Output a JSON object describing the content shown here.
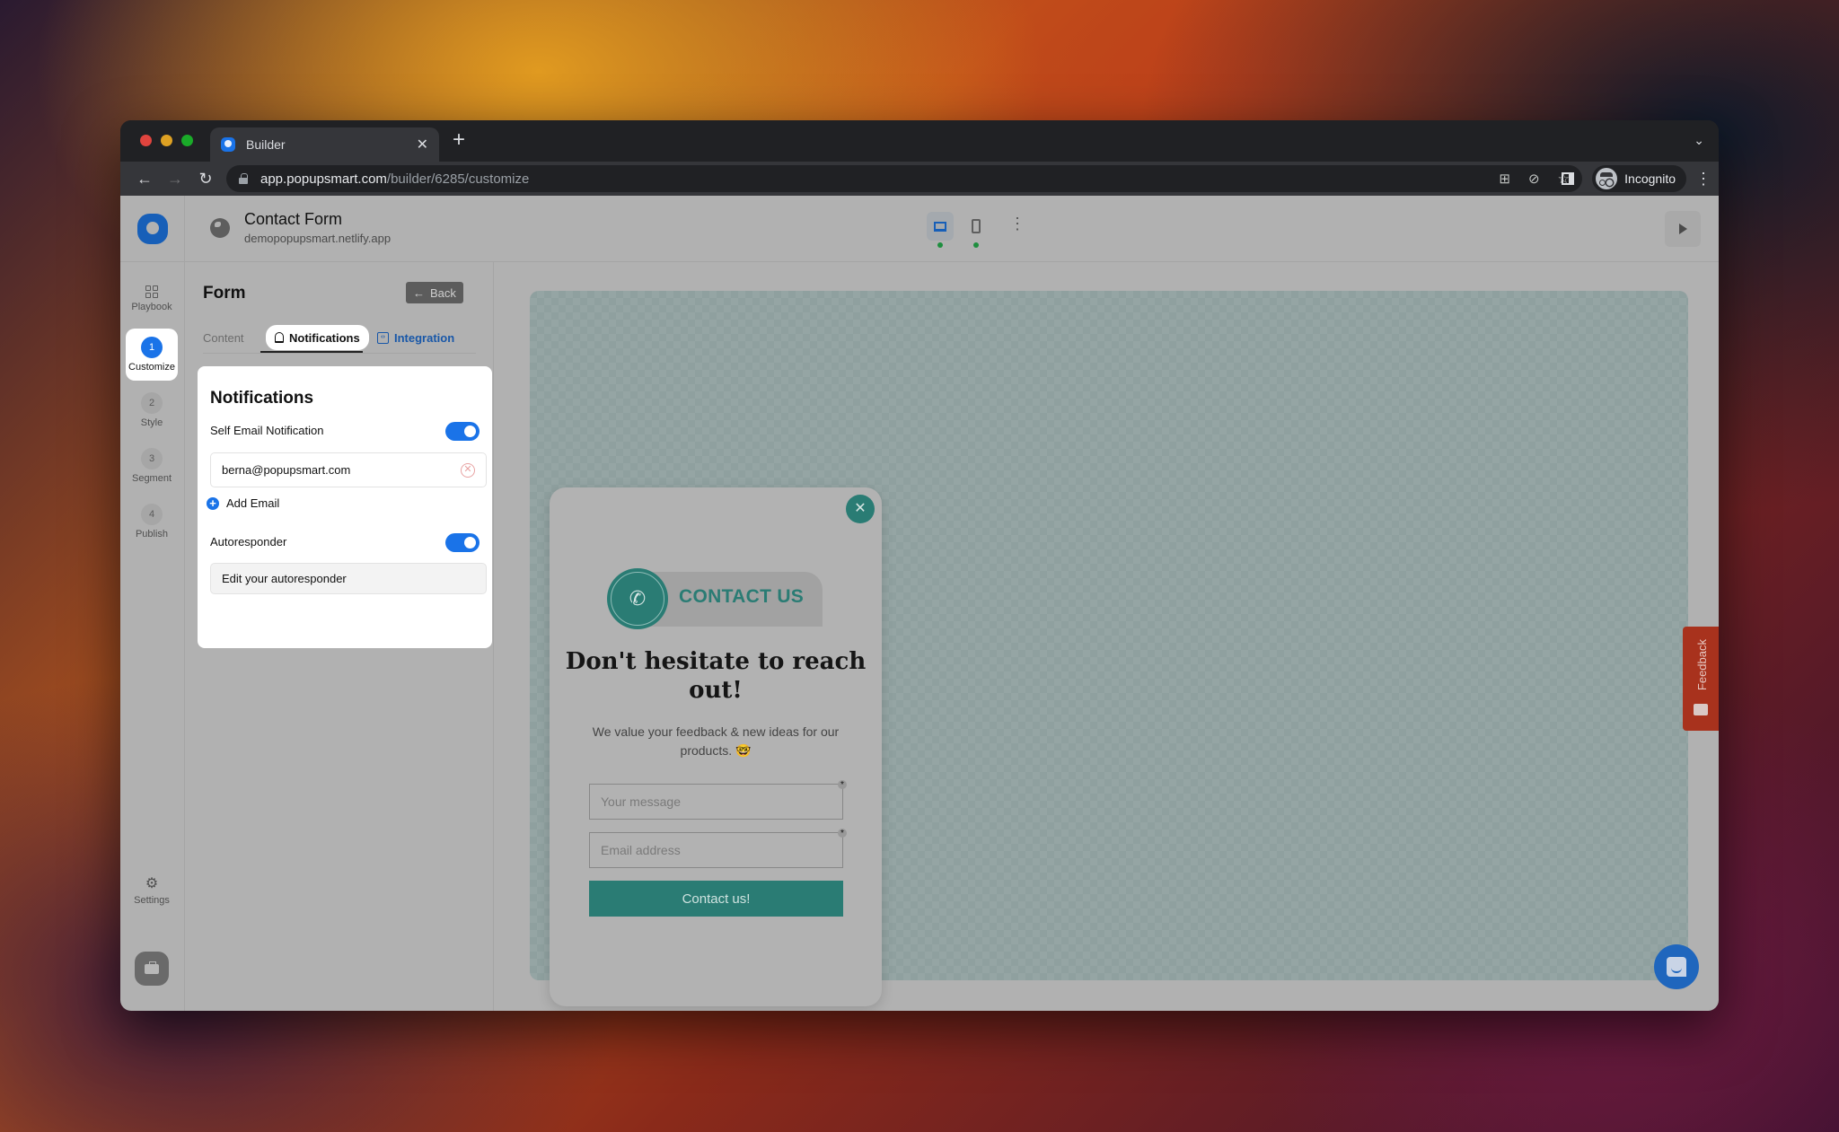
{
  "browser": {
    "tab_title": "Builder",
    "url_host": "app.popupsmart.com",
    "url_path": "/builder/6285/customize",
    "profile_label": "Incognito"
  },
  "header": {
    "project_title": "Contact Form",
    "project_domain": "demopopupsmart.netlify.app",
    "device_modes": [
      "desktop",
      "mobile"
    ],
    "active_device": "desktop"
  },
  "leftnav": {
    "items": [
      {
        "label": "Playbook",
        "icon": "grid-icon"
      },
      {
        "step": "1",
        "label": "Customize",
        "active": true
      },
      {
        "step": "2",
        "label": "Style"
      },
      {
        "step": "3",
        "label": "Segment"
      },
      {
        "step": "4",
        "label": "Publish"
      }
    ],
    "settings_label": "Settings"
  },
  "panel": {
    "title": "Form",
    "back_label": "Back",
    "tabs": [
      {
        "label": "Content"
      },
      {
        "label": "Notifications",
        "active": true
      },
      {
        "label": "Integration"
      }
    ],
    "card": {
      "title": "Notifications",
      "self_email_label": "Self Email Notification",
      "self_email_enabled": true,
      "email_value": "berna@popupsmart.com",
      "add_email_label": "Add Email",
      "autoresponder_label": "Autoresponder",
      "autoresponder_enabled": true,
      "autoresponder_field": "Edit your autoresponder"
    }
  },
  "popup": {
    "badge_text": "CONTACT US",
    "heading": "Don't hesitate to reach out!",
    "description": "We value your feedback & new ideas for our products. 🤓",
    "message_placeholder": "Your message",
    "email_placeholder": "Email address",
    "required_mark": "*",
    "submit_label": "Contact us!"
  },
  "widgets": {
    "feedback_label": "Feedback"
  },
  "colors": {
    "accent_blue": "#1a73e8",
    "popup_teal": "#2a7c74",
    "feedback_red": "#a8321d"
  }
}
